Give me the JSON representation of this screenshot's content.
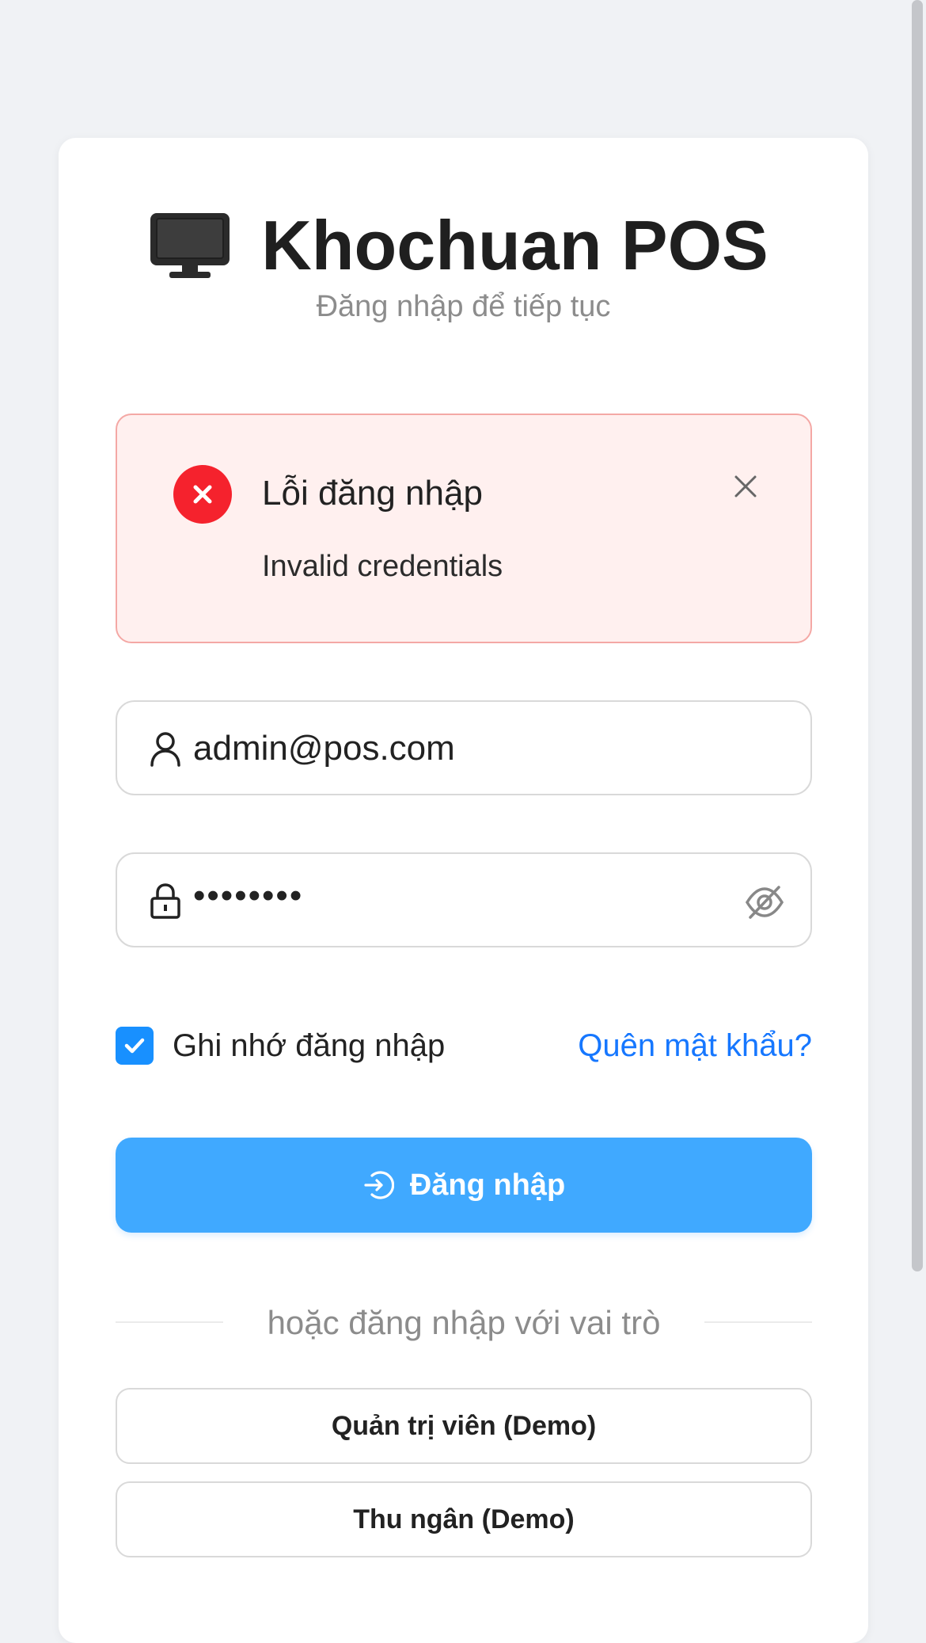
{
  "brand": {
    "title": "Khochuan POS",
    "subtitle": "Đăng nhập để tiếp tục",
    "icon": "monitor-icon"
  },
  "alert": {
    "title": "Lỗi đăng nhập",
    "message": "Invalid credentials",
    "color": "#f5222d",
    "background": "#fff0ef"
  },
  "form": {
    "username_value": "admin@pos.com",
    "password_value": "••••••••",
    "remember_label": "Ghi nhớ đăng nhập",
    "remember_checked": true,
    "forgot_label": "Quên mật khẩu?",
    "login_label": "Đăng nhập"
  },
  "divider": {
    "text": "hoặc đăng nhập với vai trò"
  },
  "roles": [
    {
      "label": "Quản trị viên (Demo)"
    },
    {
      "label": "Thu ngân (Demo)"
    }
  ],
  "colors": {
    "primary": "#1677ff",
    "button": "#40a9ff",
    "page_bg": "#f0f2f5"
  }
}
